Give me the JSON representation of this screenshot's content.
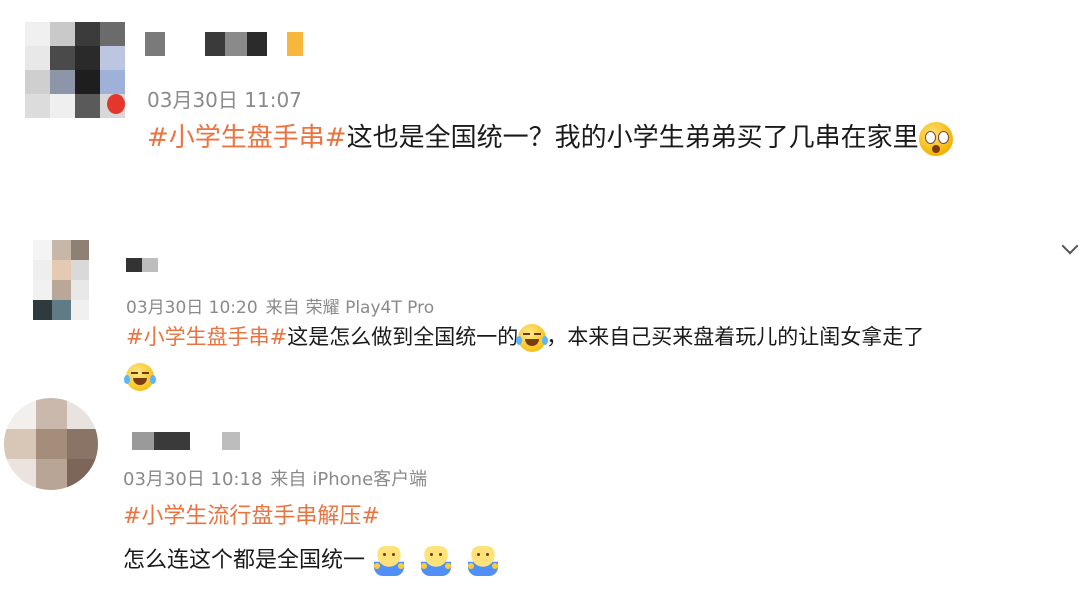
{
  "posts": [
    {
      "time": "03月30日 11:07",
      "source_prefix": "",
      "source": "",
      "topic": "#小学生盘手串#",
      "text": "这也是全国统一？我的小学生弟弟买了几串在家里",
      "text_line2": "",
      "emojis": [
        "shocked-face-icon"
      ]
    },
    {
      "time": "03月30日 10:20",
      "source_prefix": "来自",
      "source": "荣耀 Play4T Pro",
      "topic": "#小学生盘手串#",
      "text": "这是怎么做到全国统一的",
      "text_after_emoji": "，本来自己买来盘着玩儿的让闺女拿走了",
      "emojis": [
        "crying-laughing-icon",
        "crying-laughing-icon"
      ]
    },
    {
      "time": "03月30日 10:18",
      "source_prefix": "来自",
      "source": "iPhone客户端",
      "topic": "#小学生流行盘手串解压#",
      "text": "怎么连这个都是全国统一",
      "emojis": [
        "shrug-icon",
        "shrug-icon",
        "shrug-icon"
      ]
    }
  ],
  "colors": {
    "topic": "#eb7340",
    "meta": "#8a8a8a",
    "text": "#1a1a1a"
  }
}
